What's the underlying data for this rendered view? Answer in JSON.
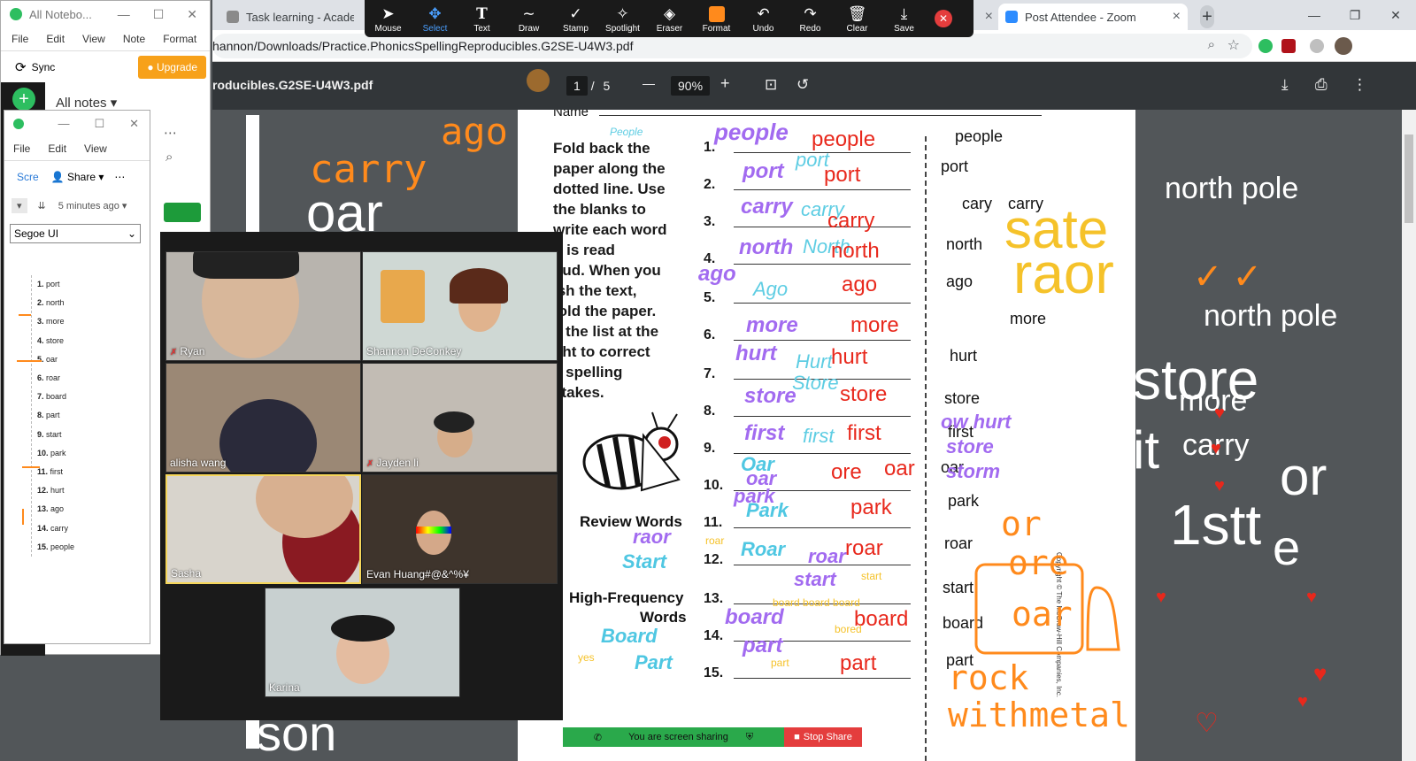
{
  "browser": {
    "tabs": [
      {
        "label": "Task learning - Academy o"
      },
      {
        "label": "Post Attendee - Zoom"
      }
    ],
    "url": "hannon/Downloads/Practice.PhonicsSpellingReproducibles.G2SE-U4W3.pdf",
    "new_tab": "+"
  },
  "pdf": {
    "filename": "roducibles.G2SE-U4W3.pdf",
    "page_current": "1",
    "page_sep": "/",
    "page_total": "5",
    "zoom": "90%",
    "zoom_minus": "—",
    "zoom_plus": "+",
    "name_label": "Name",
    "instructions": [
      "Fold back the",
      "paper along the",
      "dotted line. Use",
      "the blanks to",
      "write each word",
      "it is read",
      "oud. When you",
      "ish the text,",
      "fold the paper.",
      "e the list at the",
      "ght to correct",
      "y spelling",
      "stakes."
    ],
    "numbers": [
      "1.",
      "2.",
      "3.",
      "4.",
      "5.",
      "6.",
      "7.",
      "8.",
      "9.",
      "10.",
      "11.",
      "12.",
      "13.",
      "14.",
      "15."
    ],
    "review_label": "Review Words",
    "hf_label_1": "High-Frequency",
    "hf_label_2": "Words",
    "answer_words": [
      "people",
      "port",
      "cary",
      "carry",
      "north",
      "ago",
      "more",
      "hurt",
      "store",
      "first",
      "oar",
      "park",
      "roar",
      "start",
      "board",
      "part"
    ],
    "copyright": "Copyright © The McGraw-Hill Companies, Inc."
  },
  "annotations": {
    "left_handwriting": [
      "carry",
      "ago",
      "oar",
      "son"
    ],
    "purple": [
      "people",
      "port",
      "carry",
      "north",
      "ago",
      "more",
      "hurt",
      "store",
      "first",
      "Oar",
      "oar",
      "park",
      "raor",
      "Roar",
      "roar",
      "start",
      "board",
      "part"
    ],
    "cyan": [
      "People",
      "port",
      "carry",
      "North",
      "Ago",
      "Hurt",
      "Store",
      "first",
      "Park",
      "Start",
      "Board",
      "Part",
      "Oar",
      "Roar"
    ],
    "red": [
      "people",
      "port",
      "carry",
      "north",
      "ago",
      "more",
      "hurt",
      "store",
      "first",
      "ore",
      "oar",
      "park",
      "roar",
      "board",
      "part"
    ],
    "yellow": [
      "sate",
      "raor",
      "start",
      "board board board",
      "bored",
      "part",
      "yes",
      "roar"
    ],
    "orange": [
      "or",
      "ore",
      "oar",
      "rock",
      "withmetal"
    ],
    "right_panel": [
      "north pole",
      "north pole",
      "store",
      "more",
      "it",
      "carry",
      "or",
      "1stt",
      "e"
    ],
    "answer_extra": [
      "ow hurt",
      "store",
      "storm"
    ]
  },
  "annotate_toolbar": [
    {
      "label": "Mouse",
      "icon": "mouse-icon"
    },
    {
      "label": "Select",
      "icon": "select-icon"
    },
    {
      "label": "Text",
      "icon": "text-icon"
    },
    {
      "label": "Draw",
      "icon": "draw-icon"
    },
    {
      "label": "Stamp",
      "icon": "stamp-icon"
    },
    {
      "label": "Spotlight",
      "icon": "spotlight-icon"
    },
    {
      "label": "Eraser",
      "icon": "eraser-icon"
    },
    {
      "label": "Format",
      "icon": "format-icon"
    },
    {
      "label": "Undo",
      "icon": "undo-icon"
    },
    {
      "label": "Redo",
      "icon": "redo-icon"
    },
    {
      "label": "Clear",
      "icon": "clear-icon"
    },
    {
      "label": "Save",
      "icon": "save-icon"
    }
  ],
  "evernote_main": {
    "title": "All Notebo...",
    "menu": [
      "File",
      "Edit",
      "View",
      "Note",
      "Format"
    ],
    "sync": "Sync",
    "upgrade": "Upgrade",
    "all_notes": "All notes"
  },
  "evernote_note": {
    "menu": [
      "File",
      "Edit",
      "View"
    ],
    "share": "Share",
    "scre": "Scre",
    "time": "5 minutes ago",
    "font": "Segoe UI",
    "list": [
      {
        "n": "1.",
        "w": "port"
      },
      {
        "n": "2.",
        "w": "north"
      },
      {
        "n": "3.",
        "w": "more"
      },
      {
        "n": "4.",
        "w": "store"
      },
      {
        "n": "5.",
        "w": "oar"
      },
      {
        "n": "6.",
        "w": "roar"
      },
      {
        "n": "7.",
        "w": "board"
      },
      {
        "n": "8.",
        "w": "part"
      },
      {
        "n": "9.",
        "w": "start"
      },
      {
        "n": "10.",
        "w": "park"
      },
      {
        "n": "11.",
        "w": "first"
      },
      {
        "n": "12.",
        "w": "hurt"
      },
      {
        "n": "13.",
        "w": "ago"
      },
      {
        "n": "14.",
        "w": "carry"
      },
      {
        "n": "15.",
        "w": "people"
      }
    ]
  },
  "gallery": [
    {
      "name": "Ryan",
      "muted": true
    },
    {
      "name": "Shannon DeConkey",
      "muted": false
    },
    {
      "name": "alisha wang",
      "muted": false
    },
    {
      "name": "Jayden li",
      "muted": true
    },
    {
      "name": "Sasha",
      "muted": false
    },
    {
      "name": "Evan Huang#@&^%¥",
      "muted": false
    },
    {
      "name": "Karina",
      "muted": false
    }
  ],
  "sharebar": {
    "status": "You are screen sharing",
    "stop": "Stop Share"
  },
  "colors": {
    "purple": "#a26bf0",
    "cyan": "#5ecde3",
    "red": "#e8281c",
    "yellow": "#f5c22a",
    "orange": "#ff8a1c"
  }
}
